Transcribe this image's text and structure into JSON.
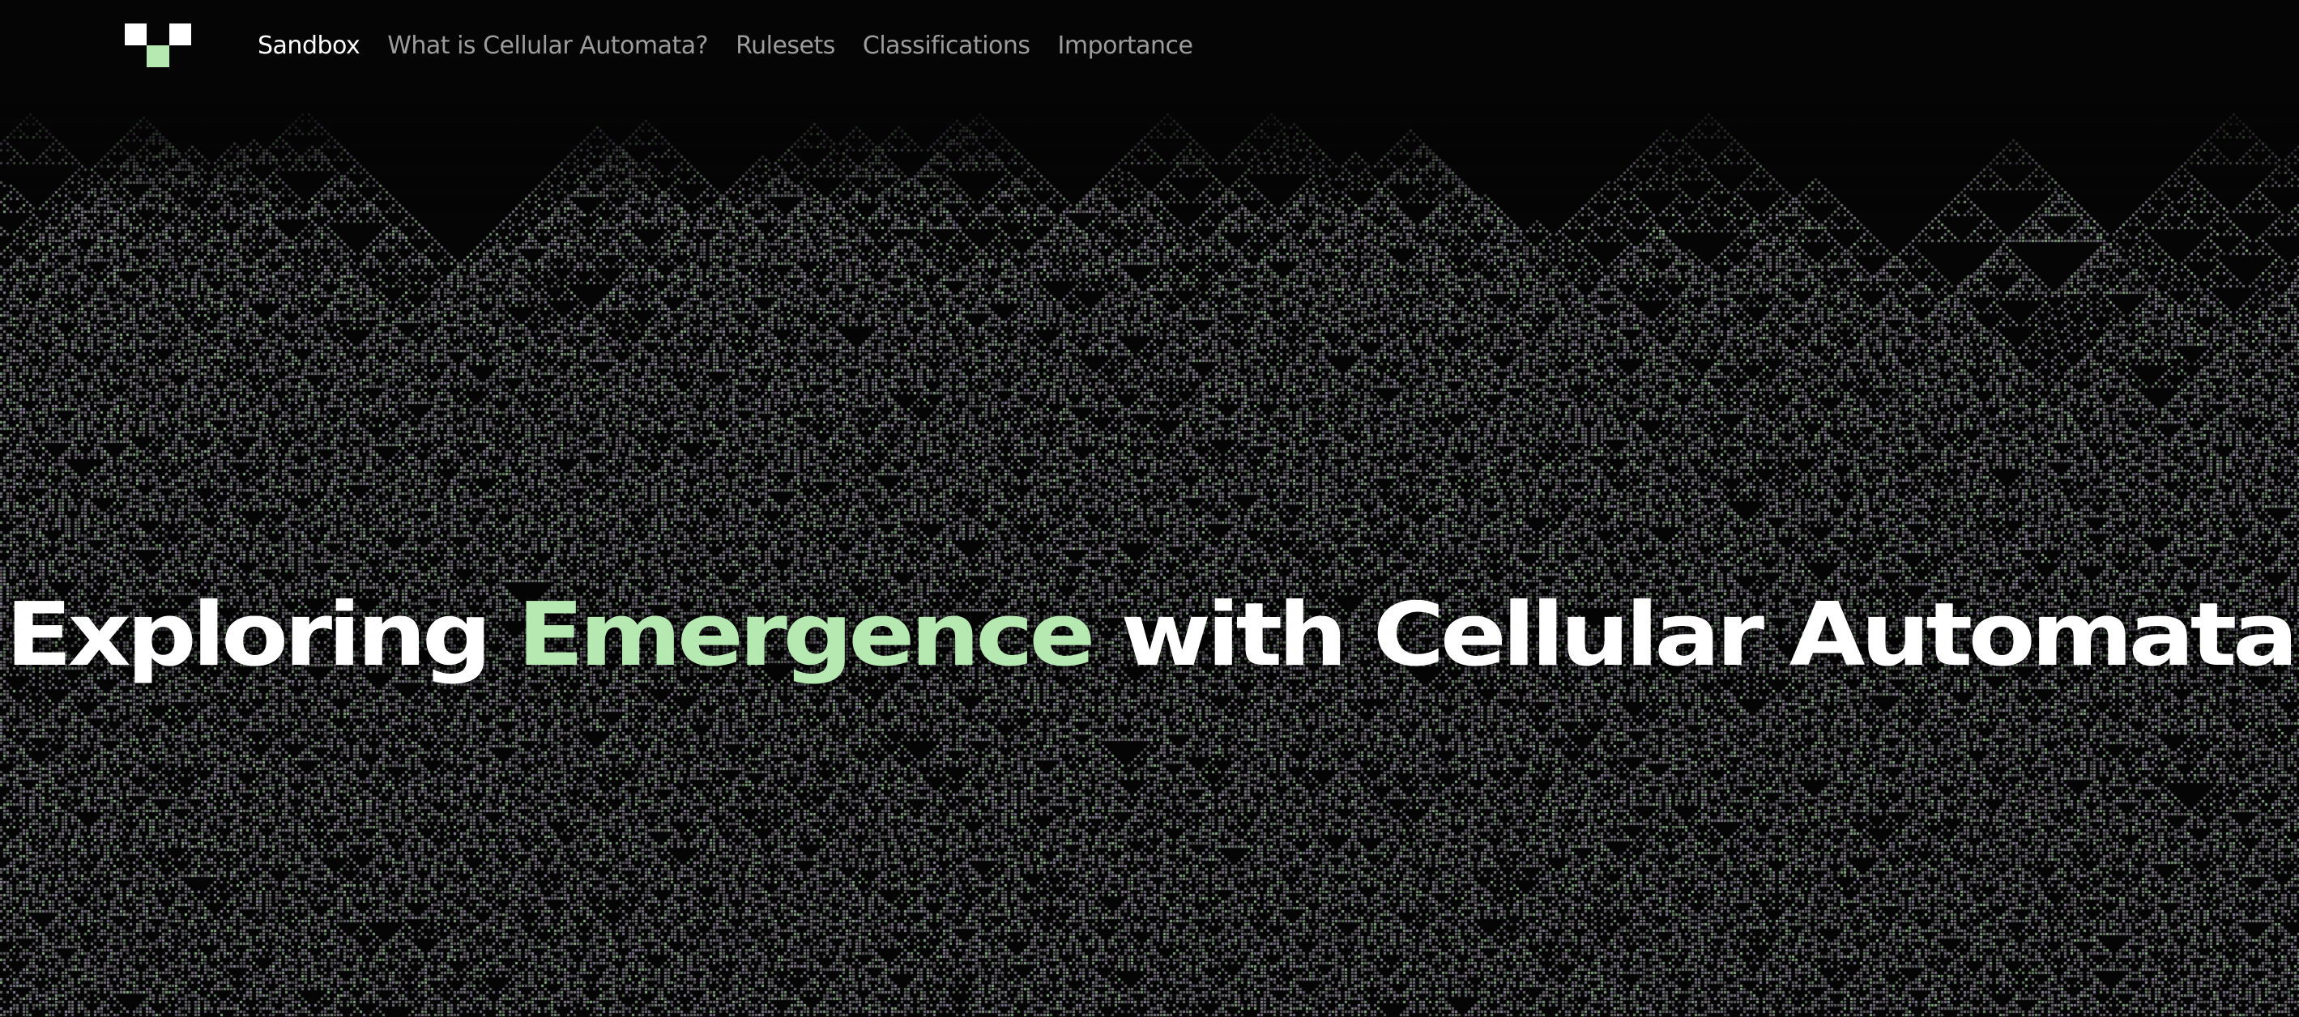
{
  "nav": {
    "logo_icon": "pixel-chevron-logo-icon",
    "links": [
      {
        "label": "Sandbox",
        "active": true
      },
      {
        "label": "What is Cellular Automata?",
        "active": false
      },
      {
        "label": "Rulesets",
        "active": false
      },
      {
        "label": "Classifications",
        "active": false
      },
      {
        "label": "Importance",
        "active": false
      }
    ]
  },
  "hero": {
    "title_before": "Exploring ",
    "title_accent": "Emergence",
    "title_after": " with Cellular Automata"
  },
  "background": {
    "pattern": "cellular-automaton-pattern",
    "cell_colors": [
      "#8c8a8f",
      "#9d94b0",
      "#9ec79a"
    ]
  },
  "colors": {
    "background": "#050505",
    "accent_green": "#b6e8b1",
    "nav_inactive": "#9c9c9c",
    "nav_active": "#ffffff",
    "title": "#ffffff"
  }
}
